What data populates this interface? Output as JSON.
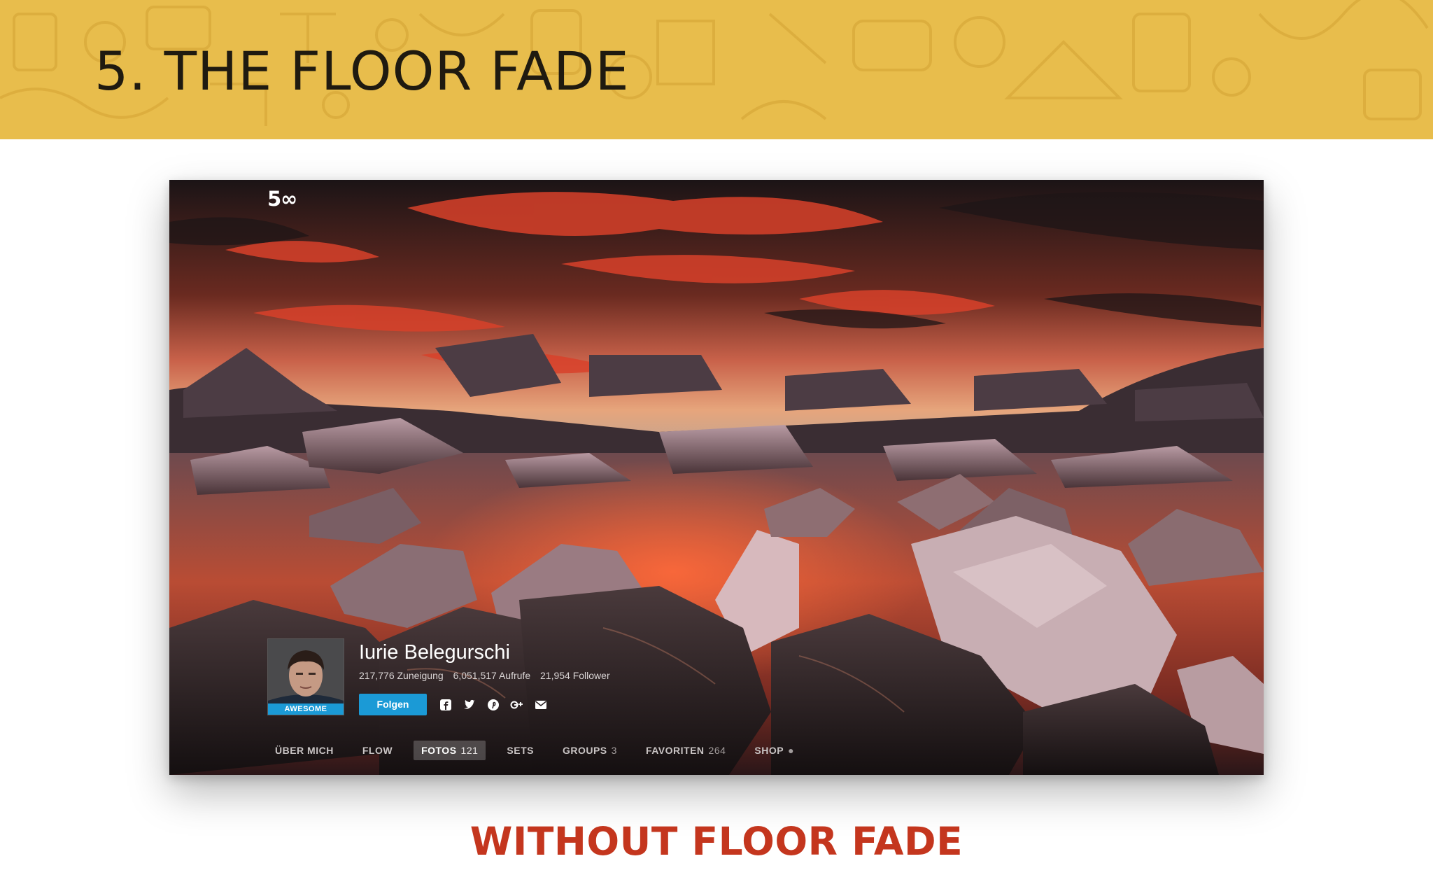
{
  "banner": {
    "title": "5. THE FLOOR FADE"
  },
  "screenshot": {
    "logo": "5∞",
    "profile": {
      "name": "Iurie Belegurschi",
      "badge": "AWESOME",
      "stats": [
        "217,776 Zuneigung",
        "6,051,517 Aufrufe",
        "21,954 Follower"
      ],
      "follow_label": "Folgen",
      "social_icons": [
        "facebook-icon",
        "twitter-icon",
        "pinterest-icon",
        "google-plus-icon",
        "mail-icon"
      ]
    },
    "tabs": [
      {
        "label": "ÜBER MICH",
        "count": ""
      },
      {
        "label": "FLOW",
        "count": ""
      },
      {
        "label": "FOTOS",
        "count": "121",
        "active": true
      },
      {
        "label": "SETS",
        "count": ""
      },
      {
        "label": "GROUPS",
        "count": "3"
      },
      {
        "label": "FAVORITEN",
        "count": "264"
      },
      {
        "label": "SHOP",
        "count": "●"
      }
    ]
  },
  "caption": "WITHOUT FLOOR FADE",
  "colors": {
    "banner": "#e8bd4c",
    "caption": "#c4361e",
    "accent_blue": "#1b9ad6"
  }
}
